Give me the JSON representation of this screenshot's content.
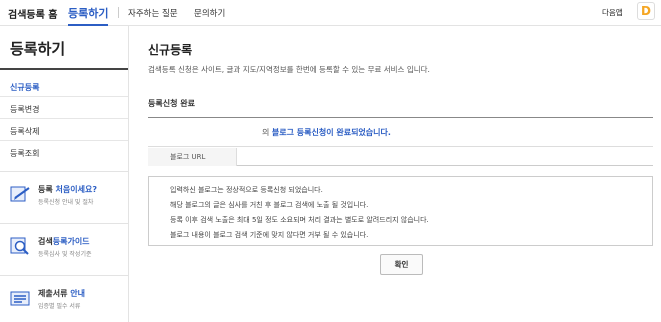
{
  "nav": {
    "home": "검색등록 홈",
    "register": "등록하기",
    "faq": "자주하는 질문",
    "qna": "문의하기",
    "daum": "다음앱",
    "logo_letter": "D"
  },
  "sidebar": {
    "title": "등록하기",
    "items": [
      {
        "label": "신규등록",
        "active": true
      },
      {
        "label": "등록변경"
      },
      {
        "label": "등록삭제"
      },
      {
        "label": "등록조회"
      }
    ],
    "promos": [
      {
        "title_a": "등록 ",
        "title_b": "처음이세요?",
        "sub": "등록신청 안내 및 절차",
        "icon": "pencil-icon"
      },
      {
        "title_a": "검색",
        "title_b": "등록가이드",
        "sub": "등록심사 및 작성기준",
        "icon": "magnifier-icon"
      },
      {
        "title_a": "제출서류 ",
        "title_b": "안내",
        "sub": "입증별 필수 서류",
        "icon": "document-icon"
      }
    ]
  },
  "main": {
    "title": "신규등록",
    "description": "검색등록 신청은 사이트, 글과 지도/지역정보를 한번에 등록할 수 있는 무료 서비스 입니다.",
    "section_title": "등록신청 완료",
    "message_prefix": "의 ",
    "message": "블로그 등록신청이 완료되었습니다.",
    "url_label": "블로그 URL",
    "notices": [
      "입력하신 블로그는 정상적으로 등록신청 되었습니다.",
      "해당 블로그의 글은 심사를 거친 후 블로그 검색에 노출 될 것입니다.",
      "등록 이후 검색 노출은 최대 5일 정도 소요되며 처리 결과는 별도로 알려드리지 않습니다.",
      "블로그 내용이 블로그 검색 기준에 맞지 않다면 거부 될 수 있습니다."
    ],
    "confirm_label": "확인"
  },
  "colors": {
    "accent": "#2c5ec4",
    "daum_logo": "#f5a623"
  }
}
